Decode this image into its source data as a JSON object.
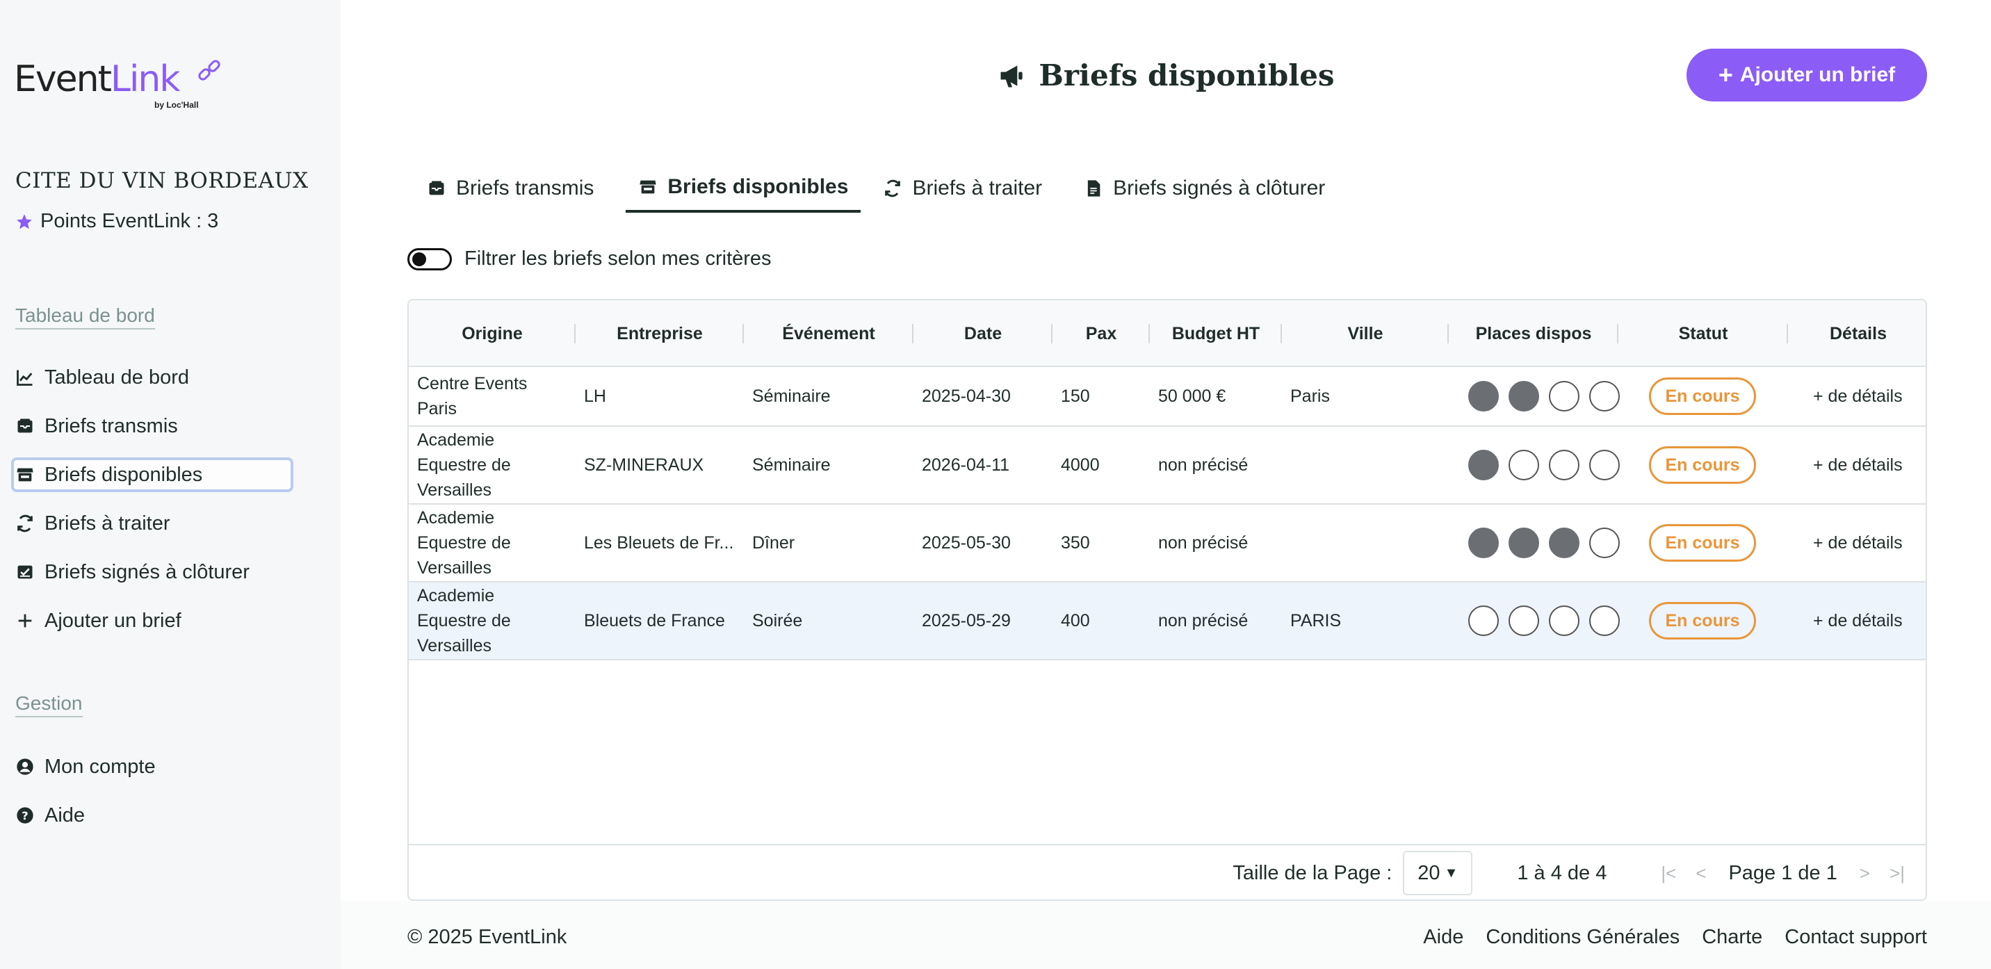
{
  "brand": {
    "logo_part1": "Event",
    "logo_part2": "Link",
    "logo_by": "by Loc'Hall",
    "accent": "#8b5cf6"
  },
  "sidebar": {
    "org_name": "CITE DU VIN BORDEAUX",
    "points": "Points EventLink : 3",
    "section_dashboard": "Tableau de bord",
    "items": [
      {
        "label": "Tableau de bord",
        "icon": "chart-line-icon"
      },
      {
        "label": "Briefs transmis",
        "icon": "inbox-icon"
      },
      {
        "label": "Briefs disponibles",
        "icon": "store-icon"
      },
      {
        "label": "Briefs à traiter",
        "icon": "refresh-icon"
      },
      {
        "label": "Briefs signés à clôturer",
        "icon": "signed-icon"
      },
      {
        "label": "Ajouter un brief",
        "icon": "plus-icon"
      }
    ],
    "section_management": "Gestion",
    "management_items": [
      {
        "label": "Mon compte",
        "icon": "user-circle-icon"
      },
      {
        "label": "Aide",
        "icon": "help-icon"
      }
    ]
  },
  "header": {
    "title": "Briefs disponibles",
    "add_button": "Ajouter un brief"
  },
  "tabs": [
    {
      "label": "Briefs transmis"
    },
    {
      "label": "Briefs disponibles",
      "active": true
    },
    {
      "label": "Briefs à traiter"
    },
    {
      "label": "Briefs signés à clôturer"
    }
  ],
  "filter": {
    "label": "Filtrer les briefs selon mes critères",
    "enabled": false
  },
  "table": {
    "columns": [
      "Origine",
      "Entreprise",
      "Événement",
      "Date",
      "Pax",
      "Budget HT",
      "Ville",
      "Places dispos",
      "Statut",
      "Détails"
    ],
    "rows": [
      {
        "origine": "Centre Events Paris",
        "entreprise": "LH",
        "evenement": "Séminaire",
        "date": "2025-04-30",
        "pax": "150",
        "budget": "50 000 €",
        "ville": "Paris",
        "places_filled": 2,
        "places_total": 4,
        "statut": "En cours",
        "details": "+ de détails"
      },
      {
        "origine": "Academie Equestre de Versailles",
        "entreprise": "SZ-MINERAUX",
        "evenement": "Séminaire",
        "date": "2026-04-11",
        "pax": "4000",
        "budget": "non précisé",
        "ville": "",
        "places_filled": 1,
        "places_total": 4,
        "statut": "En cours",
        "details": "+ de détails"
      },
      {
        "origine": "Academie Equestre de Versailles",
        "entreprise": "Les Bleuets de Fr...",
        "evenement": "Dîner",
        "date": "2025-05-30",
        "pax": "350",
        "budget": "non précisé",
        "ville": "",
        "places_filled": 3,
        "places_total": 4,
        "statut": "En cours",
        "details": "+ de détails"
      },
      {
        "origine": "Academie Equestre de Versailles",
        "entreprise": "Bleuets de France",
        "evenement": "Soirée",
        "date": "2025-05-29",
        "pax": "400",
        "budget": "non précisé",
        "ville": "PARIS",
        "places_filled": 0,
        "places_total": 4,
        "statut": "En cours",
        "details": "+ de détails"
      }
    ]
  },
  "pagination": {
    "page_size_label": "Taille de la Page :",
    "page_size": "20",
    "range": "1 à 4 de 4",
    "page_label": "Page 1 de 1"
  },
  "footer": {
    "copyright": "© 2025 EventLink",
    "links": [
      "Aide",
      "Conditions Générales",
      "Charte",
      "Contact support"
    ]
  }
}
